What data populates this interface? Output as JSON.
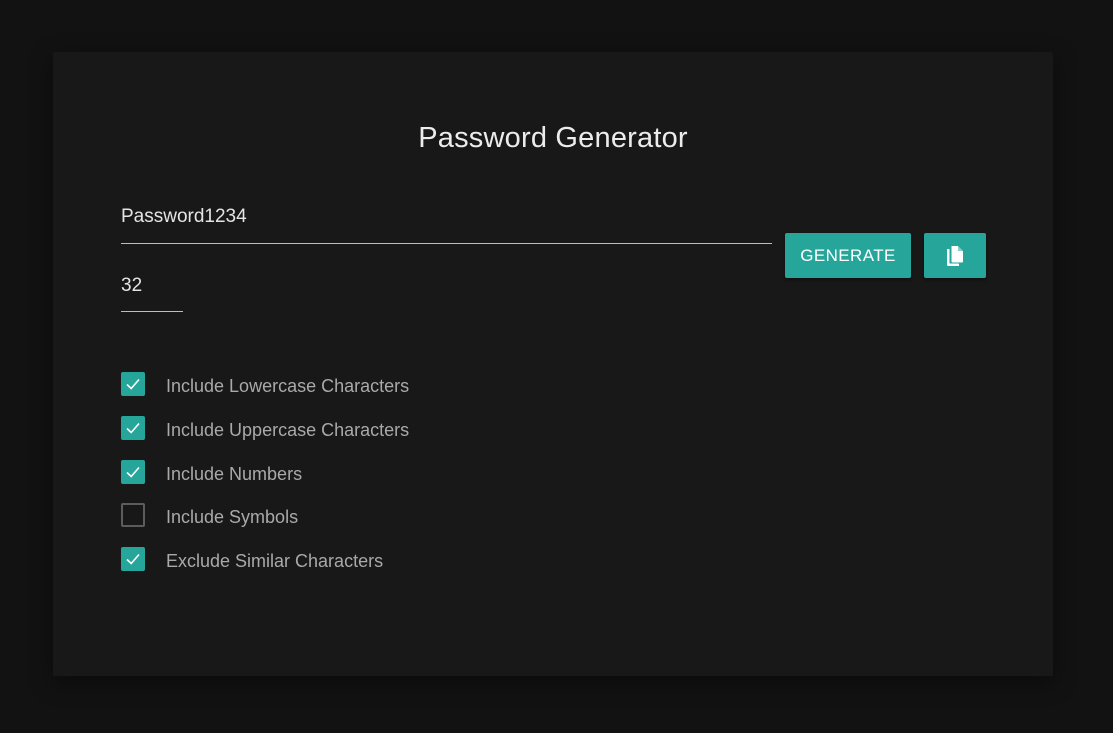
{
  "app": {
    "title": "Password Generator"
  },
  "password": {
    "value": "Password1234"
  },
  "length": {
    "value": "32"
  },
  "buttons": {
    "generate_label": "GENERATE",
    "copy_icon": "copy-icon"
  },
  "options": [
    {
      "label": "Include Lowercase Characters",
      "checked": true
    },
    {
      "label": "Include Uppercase Characters",
      "checked": true
    },
    {
      "label": "Include Numbers",
      "checked": true
    },
    {
      "label": "Include Symbols",
      "checked": false
    },
    {
      "label": "Exclude Similar Characters",
      "checked": true
    }
  ],
  "colors": {
    "accent": "#26a69a",
    "card_background": "#181818",
    "page_background": "#121212"
  }
}
